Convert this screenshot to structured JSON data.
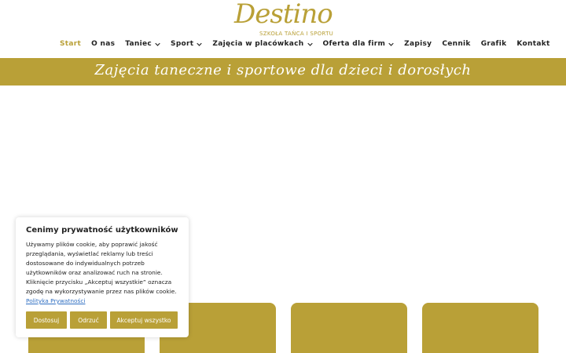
{
  "logo": {
    "script": "Destino",
    "subtitle": "SZKOŁA TAŃCA I SPORTU"
  },
  "nav": {
    "items": [
      {
        "label": "Start",
        "dropdown": false,
        "active": true
      },
      {
        "label": "O nas",
        "dropdown": false,
        "active": false
      },
      {
        "label": "Taniec",
        "dropdown": true,
        "active": false
      },
      {
        "label": "Sport",
        "dropdown": true,
        "active": false
      },
      {
        "label": "Zajęcia w placówkach",
        "dropdown": true,
        "active": false
      },
      {
        "label": "Oferta dla firm",
        "dropdown": true,
        "active": false
      },
      {
        "label": "Zapisy",
        "dropdown": false,
        "active": false
      },
      {
        "label": "Cennik",
        "dropdown": false,
        "active": false
      },
      {
        "label": "Grafik",
        "dropdown": false,
        "active": false
      },
      {
        "label": "Kontakt",
        "dropdown": false,
        "active": false
      }
    ]
  },
  "banner": {
    "text": "Zajęcia taneczne i sportowe dla dzieci i dorosłych"
  },
  "cookie": {
    "title": "Cenimy prywatność użytkowników",
    "body": "Używamy plików cookie, aby poprawić jakość przeglądania, wyświetlać reklamy lub treści dostosowane do indywidualnych potrzeb użytkowników oraz analizować ruch na stronie. Kliknięcie przycisku „Akceptuj wszystkie” oznacza zgodę na wykorzystywanie przez nas plików cookie.",
    "link": "Polityka Prywatności",
    "buttons": {
      "customize": "Dostosuj",
      "reject": "Odrzuć",
      "accept": "Akceptuj wszystko"
    }
  },
  "colors": {
    "accent": "#b9a037",
    "link": "#2f6fc2",
    "text": "#222222"
  }
}
